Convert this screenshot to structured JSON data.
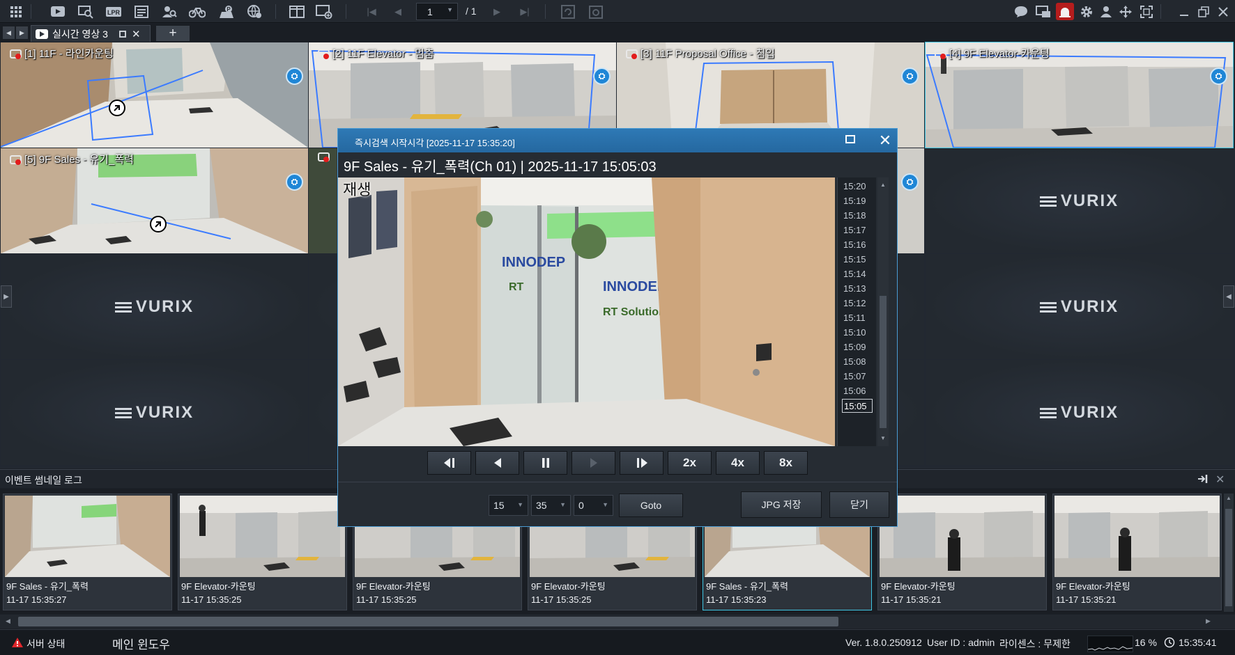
{
  "toolbar": {
    "page_current": "1",
    "page_total": "/ 1"
  },
  "tab": {
    "label": "실시간 영상 3"
  },
  "cells": [
    {
      "label": "[1] 11F - 라인카운팅"
    },
    {
      "label": "[2] 11F Elevator - 멈춤"
    },
    {
      "label": "[3] 11F Proposal Office - 침입"
    },
    {
      "label": "[4] 9F Elevator-카운팅"
    },
    {
      "label": "[5] 9F Sales - 유기_폭력"
    }
  ],
  "brand": "VURIX",
  "dialog": {
    "title": "즉시검색 시작시각 [2025-11-17 15:35:20]",
    "camera_title": "9F Sales - 유기_폭력(Ch 01) | 2025-11-17 15:05:03",
    "status": "재생",
    "timeline": [
      "15:20",
      "15:19",
      "15:18",
      "15:17",
      "15:16",
      "15:15",
      "15:14",
      "15:13",
      "15:12",
      "15:11",
      "15:10",
      "15:09",
      "15:08",
      "15:07",
      "15:06",
      "15:05"
    ],
    "timeline_selected": "15:05",
    "speed_2x": "2x",
    "speed_4x": "4x",
    "speed_8x": "8x",
    "hour": "15",
    "minute": "35",
    "second": "0",
    "goto": "Goto",
    "save_jpg": "JPG 저장",
    "close": "닫기"
  },
  "log": {
    "title": "이벤트 썸네일 로그",
    "items": [
      {
        "name": "9F Sales - 유기_폭력",
        "time": "11-17 15:35:27"
      },
      {
        "name": "9F Elevator-카운팅",
        "time": "11-17 15:35:25"
      },
      {
        "name": "9F Elevator-카운팅",
        "time": "11-17 15:35:25"
      },
      {
        "name": "9F Elevator-카운팅",
        "time": "11-17 15:35:25"
      },
      {
        "name": "9F Sales - 유기_폭력",
        "time": "11-17 15:35:23"
      },
      {
        "name": "9F Elevator-카운팅",
        "time": "11-17 15:35:21"
      },
      {
        "name": "9F Elevator-카운팅",
        "time": "11-17 15:35:21"
      }
    ]
  },
  "statusbar": {
    "server_status": "서버 상태",
    "main_window": "메인 윈도우",
    "version": "Ver. 1.8.0.250912",
    "user": "User ID : admin",
    "license": "라이센스 : 무제한",
    "cpu": "16 %",
    "clock": "15:35:41"
  },
  "colors": {
    "accent": "#2e79b5",
    "selection": "#3fc6e3",
    "roi": "#3b7bff",
    "alert": "#e21c1c"
  }
}
